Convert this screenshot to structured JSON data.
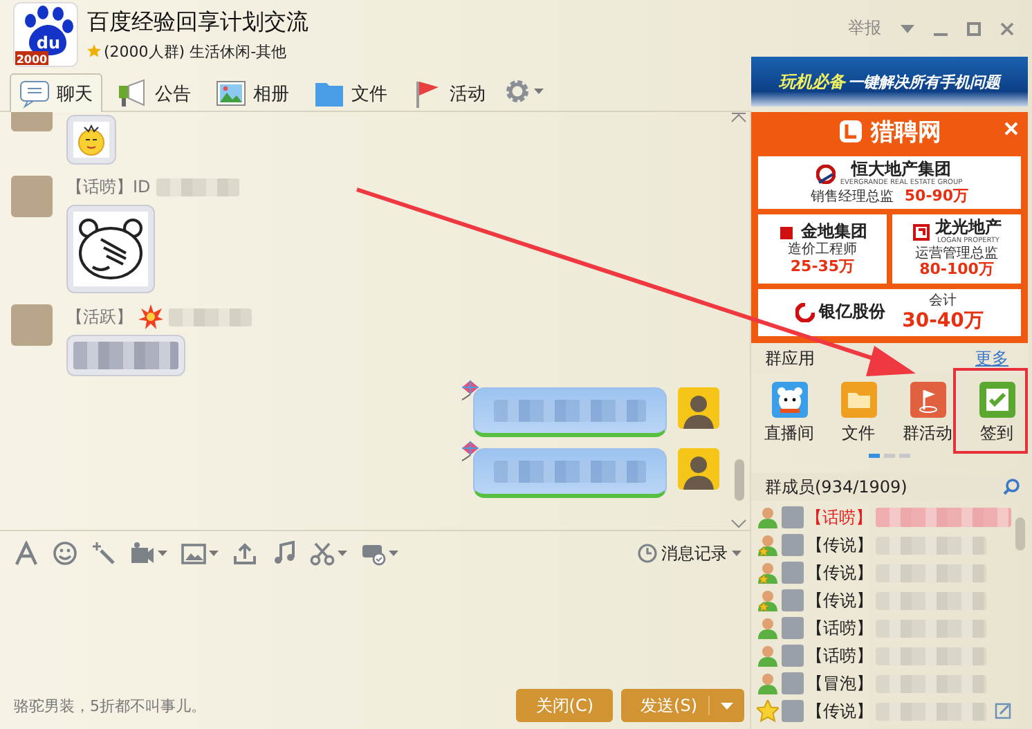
{
  "group": {
    "title": "百度经验回享计划交流",
    "meta": "(2000人群) 生活休闲-其他",
    "logo_text": "du",
    "badge": "2000"
  },
  "window_controls": {
    "report": "举报"
  },
  "tabs": [
    {
      "label": "聊天",
      "selected": true
    },
    {
      "label": "公告",
      "selected": false
    },
    {
      "label": "相册",
      "selected": false
    },
    {
      "label": "文件",
      "selected": false
    },
    {
      "label": "活动",
      "selected": false
    }
  ],
  "messages": [
    {
      "kind": "sticker"
    },
    {
      "kind": "sticker",
      "sender": "【话唠】ID"
    },
    {
      "kind": "text",
      "sender": "【活跃】",
      "burst": true
    },
    {
      "kind": "outgoing"
    },
    {
      "kind": "outgoing"
    }
  ],
  "toolbar": {
    "history": "消息记录"
  },
  "footer": {
    "ad_text": "骆驼男装，5折都不叫事儿。",
    "buttons": [
      {
        "label": "关闭(C)",
        "kind": "plain"
      },
      {
        "label": "发送(S)",
        "kind": "split"
      }
    ]
  },
  "banner": {
    "highlight": "玩机必备",
    "text": "一键解决所有手机问题"
  },
  "job_ad": {
    "brand": "猎聘网",
    "listings": [
      {
        "company": "恒大地产集团",
        "company_en": "EVERGRANDE REAL ESTATE GROUP",
        "position": "销售经理总监",
        "salary": "50-90万"
      },
      {
        "company": "金地集团",
        "position": "造价工程师",
        "salary": "25-35万"
      },
      {
        "company": "龙光地产",
        "company_en": "LOGAN PROPERTY",
        "position": "运营管理总监",
        "salary": "80-100万"
      },
      {
        "company": "银亿股份",
        "position": "会计",
        "salary": "30-40万"
      }
    ]
  },
  "apps": {
    "title": "群应用",
    "more": "更多",
    "items": [
      {
        "label": "直播间"
      },
      {
        "label": "文件"
      },
      {
        "label": "群活动"
      },
      {
        "label": "签到"
      }
    ],
    "pages": [
      {
        "selected": true
      },
      {
        "selected": false
      },
      {
        "selected": false
      }
    ]
  },
  "members": {
    "title": "群成员(934/1909)",
    "list": [
      {
        "kind": "member",
        "rank": "【话唠】",
        "color": "#e02020"
      },
      {
        "kind": "admin",
        "rank": "【传说】",
        "color": "#222222"
      },
      {
        "kind": "admin",
        "rank": "【传说】",
        "color": "#222222"
      },
      {
        "kind": "admin",
        "rank": "【传说】",
        "color": "#222222"
      },
      {
        "kind": "member",
        "rank": "【话唠】",
        "color": "#222222"
      },
      {
        "kind": "member",
        "rank": "【话唠】",
        "color": "#222222"
      },
      {
        "kind": "member",
        "rank": "【冒泡】",
        "color": "#222222"
      },
      {
        "kind": "owner",
        "rank": "【传说】",
        "color": "#222222"
      }
    ]
  }
}
